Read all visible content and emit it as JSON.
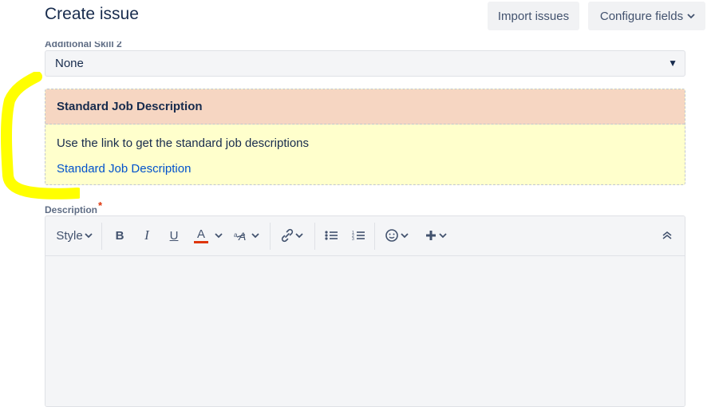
{
  "header": {
    "title": "Create issue",
    "import_label": "Import issues",
    "configure_label": "Configure fields"
  },
  "additional_skill": {
    "label": "Additional Skill 2",
    "value": "None"
  },
  "job_panel": {
    "title": "Standard Job Description",
    "text": "Use the link to get the standard job descriptions",
    "link_text": "Standard Job Description"
  },
  "description": {
    "label": "Description",
    "required_mark": "*",
    "toolbar": {
      "style_label": "Style",
      "bold": "B",
      "italic": "I",
      "underline": "U",
      "text_color": "A"
    }
  },
  "colors": {
    "panel_header": "#f6d6c2",
    "panel_body": "#ffffcc",
    "link": "#0052cc",
    "highlighter": "#ffff00"
  }
}
